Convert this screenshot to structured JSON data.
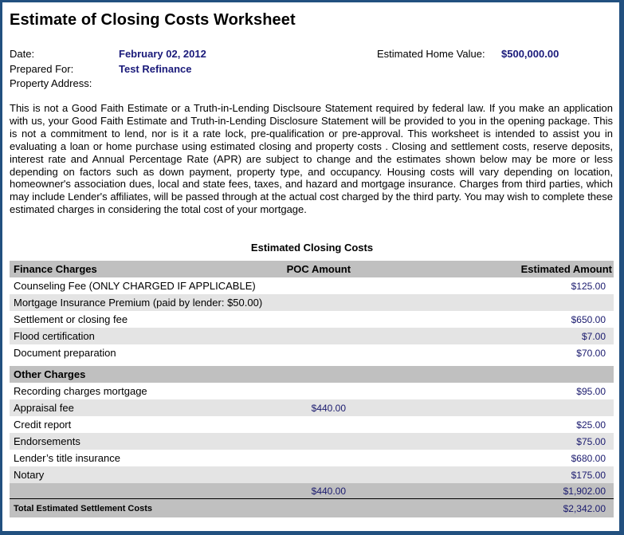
{
  "title": "Estimate of Closing Costs Worksheet",
  "info": {
    "date_label": "Date:",
    "date_value": "February 02, 2012",
    "prepared_for_label": "Prepared For:",
    "prepared_for_value": "Test Refinance",
    "property_address_label": "Property Address:",
    "property_address_value": "",
    "home_value_label": "Estimated Home Value:",
    "home_value_value": "$500,000.00"
  },
  "disclaimer": "This is not a Good Faith Estimate or a Truth-in-Lending Disclsoure Statement required by federal law.  If you make an application with us, your Good Faith Estimate and Truth-in-Lending Disclosure Statement will be provided to you in the opening package.  This is not a commitment to lend, nor is it a rate lock, pre-qualification or pre-approval.  This worksheet is intended to assist you in evaluating a loan or home purchase using estimated closing and property costs . Closing and settlement costs, reserve deposits, interest rate and Annual Percentage Rate (APR) are subject to change and the estimates shown below may be more or less depending on factors such as down payment, property type, and occupancy.  Housing costs will vary depending on location, homeowner's association dues, local and state fees, taxes, and hazard and mortgage insurance.  Charges from third parties, which may include Lender's affiliates, will be passed through at the actual cost charged by the third party.  You may wish to complete these estimated charges in considering the total cost of your mortgage.",
  "table": {
    "title": "Estimated Closing Costs",
    "columns": [
      "Finance Charges",
      "POC Amount",
      "Estimated Amount"
    ],
    "finance_charges": [
      {
        "name": "Counseling Fee (ONLY CHARGED IF APPLICABLE)",
        "poc": "",
        "est": "$125.00"
      },
      {
        "name": "Mortgage Insurance Premium (paid by lender: $50.00)",
        "poc": "",
        "est": ""
      },
      {
        "name": "Settlement or closing fee",
        "poc": "",
        "est": "$650.00"
      },
      {
        "name": "Flood certification",
        "poc": "",
        "est": "$7.00"
      },
      {
        "name": "Document preparation",
        "poc": "",
        "est": "$70.00"
      }
    ],
    "other_section_label": "Other Charges",
    "other_charges": [
      {
        "name": "Recording charges mortgage",
        "poc": "",
        "est": "$95.00"
      },
      {
        "name": "Appraisal fee",
        "poc": "$440.00",
        "est": ""
      },
      {
        "name": "Credit report",
        "poc": "",
        "est": "$25.00"
      },
      {
        "name": "Endorsements",
        "poc": "",
        "est": "$75.00"
      },
      {
        "name": "Lender’s title insurance",
        "poc": "",
        "est": "$680.00"
      },
      {
        "name": "Notary",
        "poc": "",
        "est": "$175.00"
      }
    ],
    "subtotal": {
      "poc": "$440.00",
      "est": "$1,902.00"
    },
    "total": {
      "label": "Total Estimated Settlement Costs",
      "est": "$2,342.00"
    }
  }
}
